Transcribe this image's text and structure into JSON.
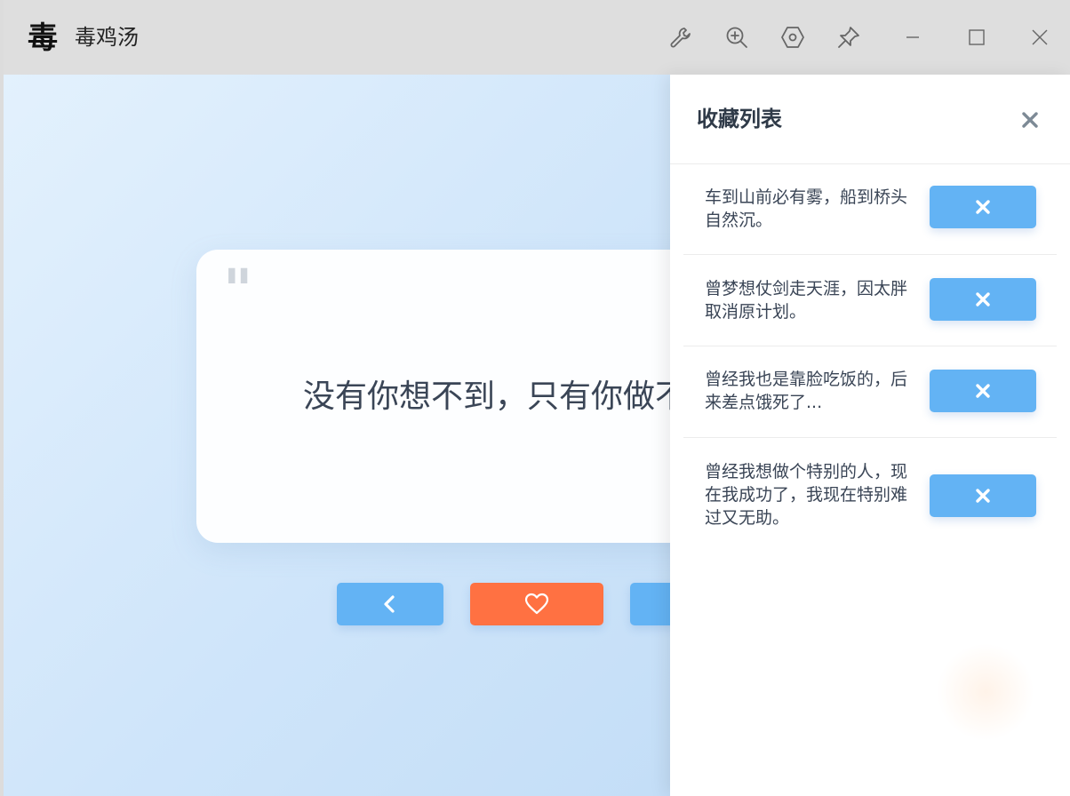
{
  "window": {
    "title": "毒鸡汤",
    "logo_glyph": "毒"
  },
  "titlebar_icons": [
    "wrench-icon",
    "zoom-in-icon",
    "hexagon-settings-icon",
    "pin-icon",
    "minimize-icon",
    "maximize-icon",
    "close-icon"
  ],
  "main": {
    "quote_mark": "\"",
    "quote_text": "没有你想不到，只有你做不到。"
  },
  "panel": {
    "title": "收藏列表",
    "items": [
      {
        "text": "车到山前必有雾，船到桥头自然沉。"
      },
      {
        "text": "曾梦想仗剑走天涯，因太胖取消原计划。"
      },
      {
        "text": "曾经我也是靠脸吃饭的，后来差点饿死了..."
      },
      {
        "text": "曾经我想做个特别的人，现在我成功了，我现在特别难过又无助。"
      }
    ]
  },
  "colors": {
    "accent_blue": "#63b3f4",
    "accent_orange": "#ff7142",
    "text_dark": "#3a4556"
  }
}
